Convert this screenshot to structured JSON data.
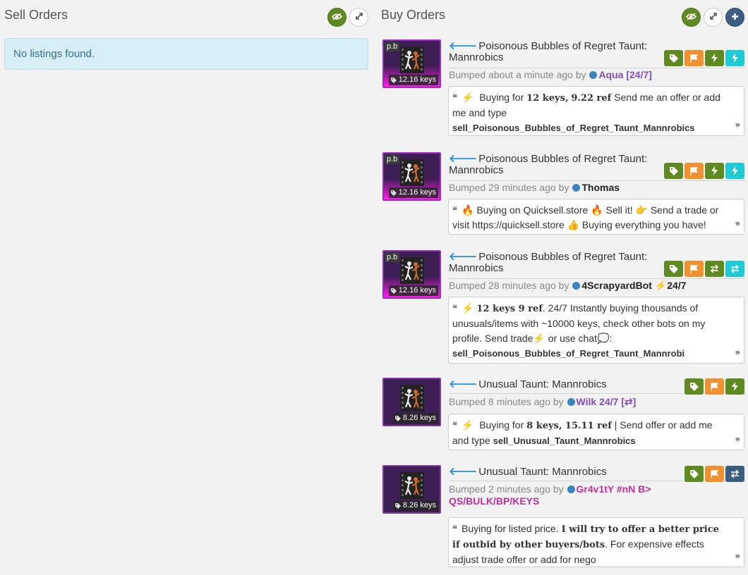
{
  "sell_orders": {
    "title": "Sell Orders",
    "empty_text": "No listings found."
  },
  "buy_orders": {
    "title": "Buy Orders",
    "listings": [
      {
        "quality_tag": "p.b",
        "price": "12.16 keys",
        "title": "Poisonous Bubbles of Regret Taunt: Mannrobics",
        "bumped_prefix": "Bumped about a minute ago by",
        "user": "Aqua [24/7]",
        "user_suffix": "",
        "user_line2": "",
        "quote_html_parts": [
          "Buying for",
          "12 keys",
          ",",
          "9.22 ref",
          "Send me an offer or add me and type"
        ],
        "trade_name": "sell_Poisonous_Bubbles_of_Regret_Taunt_Mannrobics",
        "icons": [
          "tag-icon",
          "flag-icon",
          "bolt-icon",
          "bolt-icon"
        ]
      },
      {
        "quality_tag": "p.b",
        "price": "12.16 keys",
        "title": "Poisonous Bubbles of Regret Taunt: Mannrobics",
        "bumped_prefix": "Bumped 29 minutes ago by",
        "user": "Thomas",
        "quote_text": "🔥 Buying on Quicksell.store 🔥  Sell it!  👉 Send a trade or visit https://quicksell.store 👍  Buying everything you have!"
      },
      {
        "quality_tag": "p.b",
        "price": "12.16 keys",
        "title": "Poisonous Bubbles of Regret Taunt: Mannrobics",
        "bumped_prefix": "Bumped 28 minutes ago by",
        "user": "4ScrapyardBot",
        "user_suffix": "24/7",
        "quote_bold": "12 keys 9 ref",
        "quote_text": ". 24/7 Instantly buying thousands of unusuals/items with ~10000 keys, check other bots on my profile. Send   trade",
        "quote_text2": "or   use   chat",
        "quote_text3": ":",
        "trade_name": "sell_Poisonous_Bubbles_of_Regret_Taunt_Mannrobi"
      },
      {
        "price": "8.26 keys",
        "title": "Unusual Taunt: Mannrobics",
        "bumped_prefix": "Bumped 8 minutes ago by",
        "user": "Wilk 24/7 [⇄]",
        "quote_prefix": "Buying for",
        "quote_bold": "8 keys, 15.11 ref",
        "quote_text": "| Send offer or add me and type",
        "trade_name": "sell_Unusual_Taunt_Mannrobics"
      },
      {
        "price": "8.26 keys",
        "title": "Unusual Taunt: Mannrobics",
        "bumped_prefix": "Bumped 2 minutes ago by",
        "user": "Gr4v1tY #nN B>",
        "user_line2": "QS/BULK/BP/KEYS",
        "quote_prefix": "Buying for listed price.",
        "quote_bold": "I will try to offer a better price if outbid by other buyers/bots",
        "quote_text": ". For expensive effects adjust trade offer or add for nego"
      }
    ]
  },
  "colors": {
    "green": "#5f8a1f",
    "orange": "#f0902f",
    "cyan": "#1ccbd6",
    "slate": "#3c5e7c",
    "unusual_purple": "#7d3c9a",
    "info_bg": "#d8eef7"
  }
}
